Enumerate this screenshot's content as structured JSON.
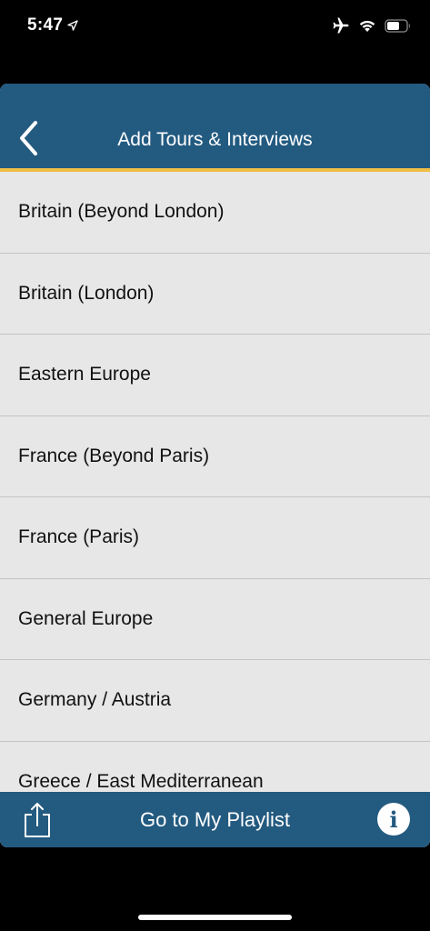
{
  "status_bar": {
    "time": "5:47",
    "icons": [
      "location-arrow-icon",
      "airplane-icon",
      "wifi-icon",
      "battery-icon"
    ]
  },
  "nav": {
    "title": "Add Tours & Interviews",
    "back_icon": "chevron-left-icon"
  },
  "list": {
    "items": [
      {
        "label": "Britain (Beyond London)"
      },
      {
        "label": "Britain (London)"
      },
      {
        "label": "Eastern Europe"
      },
      {
        "label": "France (Beyond Paris)"
      },
      {
        "label": "France (Paris)"
      },
      {
        "label": "General Europe"
      },
      {
        "label": "Germany / Austria"
      },
      {
        "label": "Greece / East Mediterranean"
      }
    ]
  },
  "toolbar": {
    "playlist_label": "Go to My Playlist",
    "share_icon": "share-icon",
    "info_icon": "info-icon",
    "info_glyph": "i"
  },
  "colors": {
    "nav_background": "#235a80",
    "accent_stripe": "#f0bd46",
    "list_background": "#e7e7e7",
    "separator": "#c4c4c4"
  }
}
